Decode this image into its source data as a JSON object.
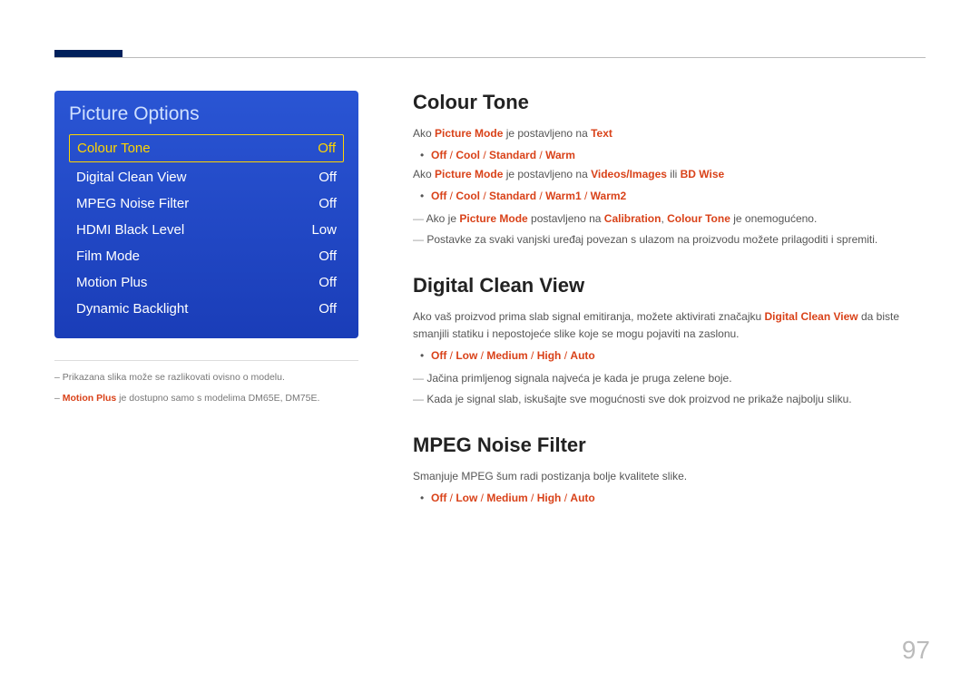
{
  "menu": {
    "title": "Picture Options",
    "items": [
      {
        "label": "Colour Tone",
        "value": "Off",
        "selected": true
      },
      {
        "label": "Digital Clean View",
        "value": "Off",
        "selected": false
      },
      {
        "label": "MPEG Noise Filter",
        "value": "Off",
        "selected": false
      },
      {
        "label": "HDMI Black Level",
        "value": "Low",
        "selected": false
      },
      {
        "label": "Film Mode",
        "value": "Off",
        "selected": false
      },
      {
        "label": "Motion Plus",
        "value": "Off",
        "selected": false
      },
      {
        "label": "Dynamic Backlight",
        "value": "Off",
        "selected": false
      }
    ]
  },
  "footnotes": {
    "f1": "Prikazana slika može se razlikovati ovisno o modelu.",
    "f2_hl": "Motion Plus",
    "f2_rest": " je dostupno samo s modelima DM65E, DM75E."
  },
  "sections": {
    "colour_tone": {
      "heading": "Colour Tone",
      "l1_pre": "Ako ",
      "l1_hl1": "Picture Mode",
      "l1_mid": " je postavljeno na ",
      "l1_hl2": "Text",
      "b1_a": "Off",
      "b1_b": "Cool",
      "b1_c": "Standard",
      "b1_d": "Warm",
      "l2_pre": "Ako ",
      "l2_hl1": "Picture Mode",
      "l2_mid": " je postavljeno na ",
      "l2_hl2": "Videos/Images",
      "l2_or": " ili ",
      "l2_hl3": "BD Wise",
      "b2_a": "Off",
      "b2_b": "Cool",
      "b2_c": "Standard",
      "b2_d": "Warm1",
      "b2_e": "Warm2",
      "d1_pre": "Ako je ",
      "d1_hl1": "Picture Mode",
      "d1_mid1": " postavljeno na ",
      "d1_hl2": "Calibration",
      "d1_comma": ", ",
      "d1_hl3": "Colour Tone",
      "d1_rest": " je onemogućeno.",
      "d2": "Postavke za svaki vanjski uređaj povezan s ulazom na proizvodu možete prilagoditi i spremiti."
    },
    "dcv": {
      "heading": "Digital Clean View",
      "p1_pre": "Ako vaš proizvod prima slab signal emitiranja, možete aktivirati značajku ",
      "p1_hl": "Digital Clean View",
      "p1_post": " da biste smanjili statiku i nepostojeće slike koje se mogu pojaviti na zaslonu.",
      "b1_a": "Off",
      "b1_b": "Low",
      "b1_c": "Medium",
      "b1_d": "High",
      "b1_e": "Auto",
      "d1": "Jačina primljenog signala najveća je kada je pruga zelene boje.",
      "d2": "Kada je signal slab, iskušajte sve mogućnosti sve dok proizvod ne prikaže najbolju sliku."
    },
    "mpeg": {
      "heading": "MPEG Noise Filter",
      "p1": "Smanjuje MPEG šum radi postizanja bolje kvalitete slike.",
      "b1_a": "Off",
      "b1_b": "Low",
      "b1_c": "Medium",
      "b1_d": "High",
      "b1_e": "Auto"
    }
  },
  "page_number": "97"
}
